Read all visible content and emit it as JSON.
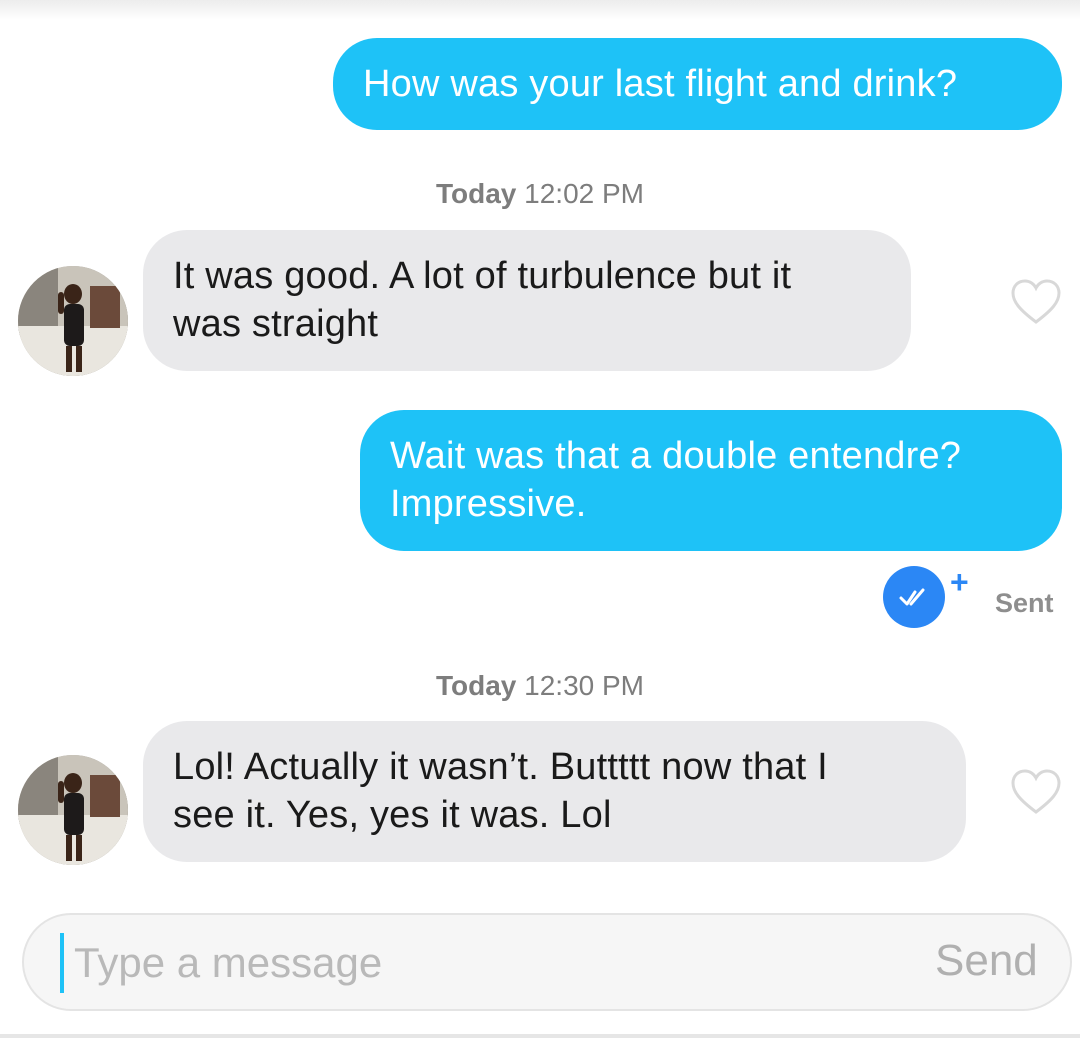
{
  "messages": [
    {
      "direction": "outgoing",
      "lines": [
        "How was your last flight and drink?"
      ]
    },
    {
      "direction": "incoming",
      "lines": [
        "It was good. A lot of turbulence but it",
        "was straight"
      ]
    },
    {
      "direction": "outgoing",
      "lines": [
        "Wait was that a double entendre?",
        "Impressive."
      ]
    },
    {
      "direction": "incoming",
      "lines": [
        "Lol! Actually it wasn’t.  Buttttt now that I",
        "see it.  Yes, yes it was. Lol"
      ]
    }
  ],
  "timestamps": [
    {
      "day": "Today",
      "time": "12:02 PM"
    },
    {
      "day": "Today",
      "time": "12:30 PM"
    }
  ],
  "status": {
    "plus": "+",
    "label": "Sent"
  },
  "composer": {
    "placeholder": "Type a message",
    "send_label": "Send"
  },
  "icons": {
    "like": "heart-outline-icon",
    "read": "double-check-icon"
  },
  "colors": {
    "outgoing_bubble": "#1ec2f7",
    "incoming_bubble": "#e9e9eb",
    "read_badge": "#2b87f5",
    "cursor": "#1ec2f7"
  }
}
